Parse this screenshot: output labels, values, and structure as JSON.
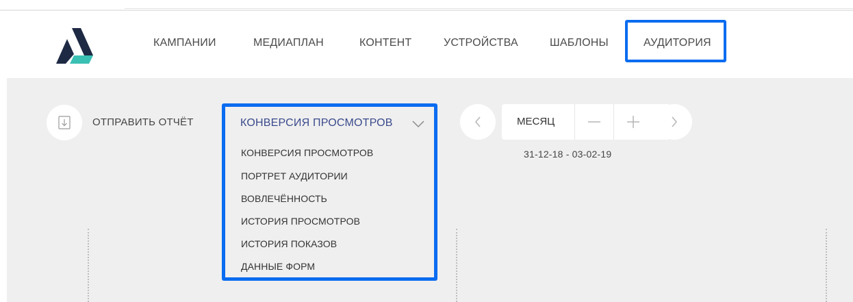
{
  "nav": {
    "items": [
      {
        "label": "КАМПАНИИ"
      },
      {
        "label": "МЕДИАПЛАН"
      },
      {
        "label": "КОНТЕНТ"
      },
      {
        "label": "УСТРОЙСТВА"
      },
      {
        "label": "ШАБЛОНЫ"
      },
      {
        "label": "АУДИТОРИЯ",
        "active": true
      }
    ]
  },
  "toolbar": {
    "send_report_icon": "download-icon",
    "send_report_label": "ОТПРАВИТЬ ОТЧЁТ",
    "report_select": {
      "selected": "КОНВЕРСИЯ ПРОСМОТРОВ",
      "options": [
        "КОНВЕРСИЯ ПРОСМОТРОВ",
        "ПОРТРЕТ АУДИТОРИИ",
        "ВОВЛЕЧЁННОСТЬ",
        "ИСТОРИЯ ПРОСМОТРОВ",
        "ИСТОРИЯ ПОКАЗОВ",
        "ДАННЫЕ ФОРМ"
      ]
    },
    "period": {
      "label": "МЕСЯЦ",
      "date_range": "31-12-18 - 03-02-19"
    }
  },
  "colors": {
    "highlight": "#0a6cf0",
    "logo_dark": "#1e2a44",
    "logo_teal": "#3bc0b4",
    "selected_text": "#3a4a8c",
    "content_bg": "#efefef"
  }
}
